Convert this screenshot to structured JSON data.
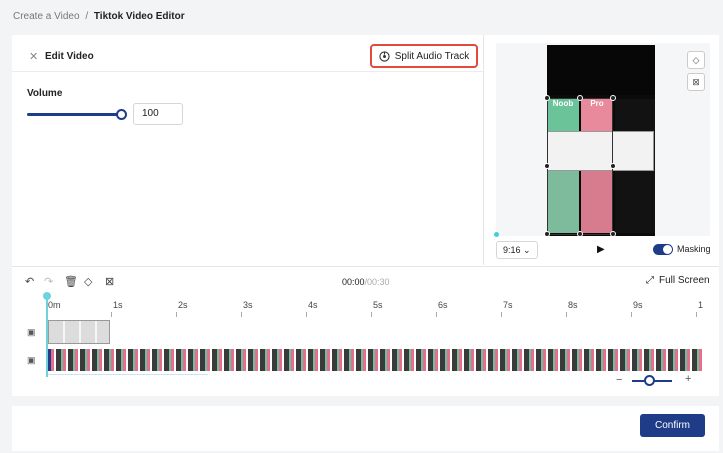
{
  "breadcrumb": {
    "parent": "Create a Video",
    "separator": "/",
    "current": "Tiktok Video Editor"
  },
  "edit_panel": {
    "title": "Edit Video",
    "split_button": "Split Audio Track",
    "volume_label": "Volume",
    "volume_value": "100",
    "volume_level_percent": 100
  },
  "preview": {
    "tiles": {
      "a": "Noob",
      "b": "Pro"
    },
    "aspect_ratio": "9:16",
    "masking_label": "Masking",
    "masking_enabled": true
  },
  "timeline": {
    "current_time": "00:00",
    "total_time": "/00:30",
    "fullscreen_label": "Full Screen",
    "ticks": [
      "0m",
      "1s",
      "2s",
      "3s",
      "4s",
      "5s",
      "6s",
      "7s",
      "8s",
      "9s",
      "1"
    ]
  },
  "footer": {
    "confirm_label": "Confirm"
  },
  "colors": {
    "accent": "#1f3c88",
    "highlight": "#e24b3b",
    "playhead": "#6fd3de"
  }
}
